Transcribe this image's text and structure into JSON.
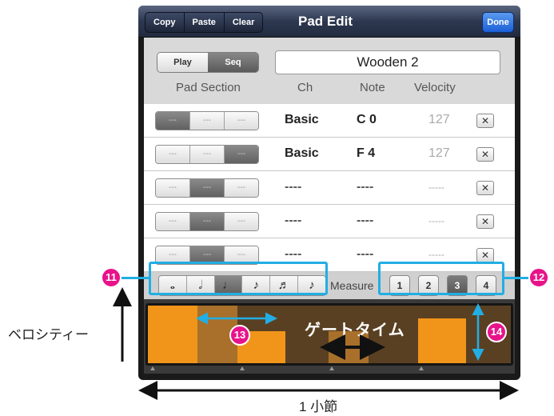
{
  "navbar": {
    "copy": "Copy",
    "paste": "Paste",
    "clear": "Clear",
    "title": "Pad Edit",
    "done": "Done"
  },
  "mode": {
    "play": "Play",
    "seq": "Seq",
    "selected": "Seq"
  },
  "pattern_name": "Wooden 2",
  "headers": {
    "pad_section": "Pad Section",
    "ch": "Ch",
    "note": "Note",
    "velocity": "Velocity"
  },
  "rows": [
    {
      "pads": [
        "---",
        "---",
        "---"
      ],
      "active": 0,
      "ch": "Basic",
      "note": "C  0",
      "velocity": "127"
    },
    {
      "pads": [
        "---",
        "---",
        "---"
      ],
      "active": 2,
      "ch": "Basic",
      "note": "F  4",
      "velocity": "127"
    },
    {
      "pads": [
        "---",
        "---",
        "---"
      ],
      "active": 1,
      "ch": "----",
      "note": "----",
      "velocity": "-----"
    },
    {
      "pads": [
        "---",
        "---",
        "---"
      ],
      "active": 1,
      "ch": "----",
      "note": "----",
      "velocity": "-----"
    },
    {
      "pads": [
        "---",
        "---",
        "---"
      ],
      "active": 1,
      "ch": "----",
      "note": "----",
      "velocity": "-----"
    }
  ],
  "delete_label": "✕",
  "note_lengths": [
    "𝅝",
    "𝅗𝅥",
    "♩",
    "♪",
    "♬",
    "♪"
  ],
  "note_length_selected": 2,
  "measure_label": "Measure",
  "measures": [
    "1",
    "2",
    "3",
    "4"
  ],
  "measure_selected": 2,
  "gate_label": "ゲートタイム",
  "callouts": {
    "c11": "11",
    "c12": "12",
    "c13": "13",
    "c14": "14"
  },
  "annotations": {
    "velocity": "ベロシティー",
    "one_measure": "1 小節"
  },
  "colors": {
    "callout": "#22aee4",
    "badge": "#e8138a",
    "gate_bar": "#f0951a"
  }
}
